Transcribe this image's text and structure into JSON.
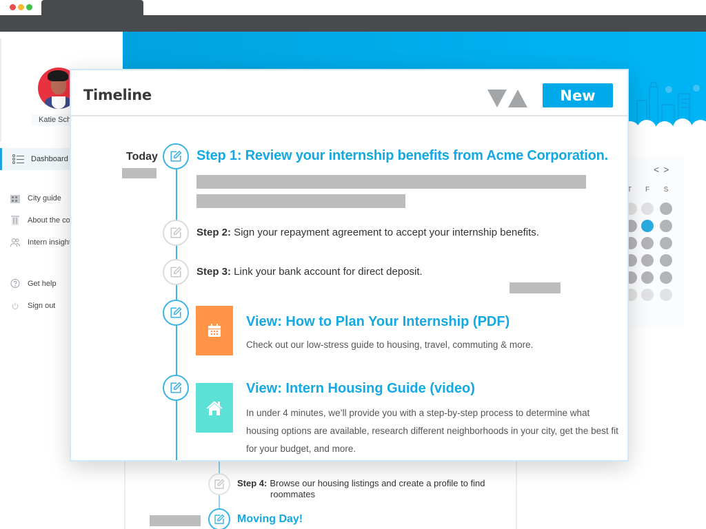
{
  "browser": {
    "window_controls": [
      "close",
      "minimize",
      "maximize"
    ]
  },
  "sidebar": {
    "user_name": "Katie Sch",
    "items": [
      {
        "label": "Dashboard",
        "icon": "list-icon",
        "active": true
      },
      {
        "label": "City guide",
        "icon": "city-icon"
      },
      {
        "label": "About the co",
        "icon": "building-icon"
      },
      {
        "label": "Intern insight",
        "icon": "people-icon"
      },
      {
        "label": "Get help",
        "icon": "help-icon"
      },
      {
        "label": "Sign out",
        "icon": "power-icon"
      }
    ]
  },
  "calendar": {
    "nav_prev": "<",
    "nav_next": ">",
    "day_headers": [
      "T",
      "F",
      "S"
    ],
    "accent": "#29abe2"
  },
  "modal": {
    "title": "Timeline",
    "new_button": "New",
    "sort_icons": [
      "sort-descending-icon",
      "sort-ascending-icon"
    ],
    "today_label": "Today",
    "step1": {
      "title": "Step 1: Review your internship benefits from Acme Corporation."
    },
    "step2": {
      "prefix": "Step 2:",
      "text": " Sign your repayment agreement to accept your internship benefits."
    },
    "step3": {
      "prefix": "Step 3:",
      "text": " Link your bank account for direct deposit."
    },
    "resources": [
      {
        "title": "View: How to Plan Your Internship (PDF)",
        "description": "Check out our low-stress guide to housing, travel, commuting & more.",
        "icon": "calendar-icon",
        "color": "#ff9447"
      },
      {
        "title": "View: Intern Housing Guide (video)",
        "description": "In under 4 minutes, we’ll provide you with a step-by-step process to determine what housing options are available, research different neighborhoods in your city, get the best fit for your budget, and more.",
        "icon": "house-icon",
        "color": "#5ce1d6"
      }
    ]
  },
  "background_timeline": {
    "step4": {
      "prefix": "Step 4:",
      "text": "Browse our housing listings and create a profile to find",
      "text_cont": "roommates"
    },
    "moving_day": "Moving Day!"
  },
  "colors": {
    "accent": "#14a9e2",
    "button": "#00a9ea",
    "chrome": "#474b4e",
    "hero": "#00aeef"
  }
}
